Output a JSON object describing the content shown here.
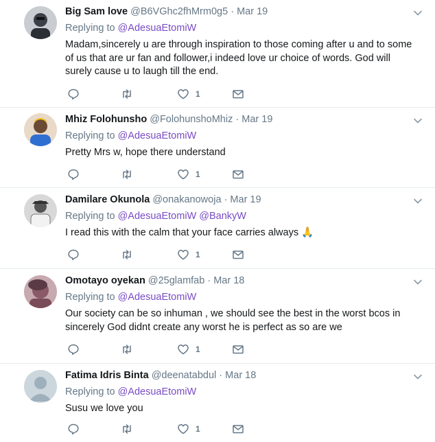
{
  "tweets": [
    {
      "name": "Big Sam love",
      "handle": "@B6VGhc2fhMrm0g5",
      "time": "Mar 19",
      "replying_label": "Replying to",
      "replying_to": [
        "@AdesuaEtomiW"
      ],
      "text": "Madam,sincerely u are through inspiration to those coming after u and to some of us that are ur fan and follower,i indeed love ur choice of words. God will surely cause u to laugh till the end.",
      "likes": "1",
      "avatar_color": "#3b3f47"
    },
    {
      "name": "Mhiz Folohunsho",
      "handle": "@FolohunshoMhiz",
      "time": "Mar 19",
      "replying_label": "Replying to",
      "replying_to": [
        "@AdesuaEtomiW"
      ],
      "text": "Pretty Mrs w, hope there understand",
      "likes": "1",
      "avatar_color": "#6b4a33"
    },
    {
      "name": "Damilare Okunola",
      "handle": "@onakanowoja",
      "time": "Mar 19",
      "replying_label": "Replying to",
      "replying_to": [
        "@AdesuaEtomiW",
        "@BankyW"
      ],
      "text": "I read this with the calm that your face carries always 🙏",
      "likes": "1",
      "avatar_color": "#9a9a9a"
    },
    {
      "name": "Omotayo oyekan",
      "handle": "@25glamfab",
      "time": "Mar 18",
      "replying_label": "Replying to",
      "replying_to": [
        "@AdesuaEtomiW"
      ],
      "text": "Our society can be so inhuman , we should see the best in the worst bcos in sincerely God didnt create any worst he is perfect as so are we",
      "likes": "1",
      "avatar_color": "#8a5a68"
    },
    {
      "name": "Fatima Idris Binta",
      "handle": "@deenatabdul",
      "time": "Mar 18",
      "replying_label": "Replying to",
      "replying_to": [
        "@AdesuaEtomiW"
      ],
      "text": "Susu we love you",
      "likes": "1",
      "avatar_color": "#ccd6dd"
    }
  ],
  "colors": {
    "link": "#794bc4",
    "muted": "#657786",
    "text": "#14171a",
    "divider": "#e6ecf0"
  },
  "icons": {
    "reply": "reply-icon",
    "retweet": "retweet-icon",
    "like": "heart-icon",
    "dm": "envelope-icon",
    "menu": "chevron-down-icon"
  }
}
